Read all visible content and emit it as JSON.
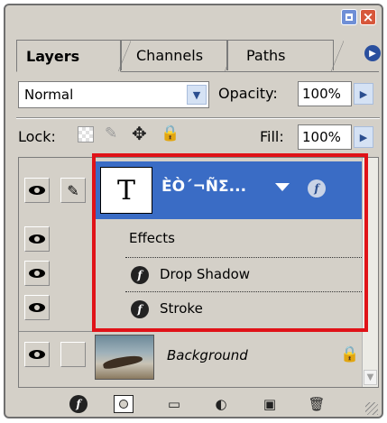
{
  "tabs": [
    {
      "label": "Layers",
      "active": true
    },
    {
      "label": "Channels",
      "active": false
    },
    {
      "label": "Paths",
      "active": false
    }
  ],
  "blend_mode": "Normal",
  "opacity": {
    "label": "Opacity:",
    "value": "100%"
  },
  "lock": {
    "label": "Lock:"
  },
  "fill": {
    "label": "Fill:",
    "value": "100%"
  },
  "layers": {
    "text_layer": {
      "thumb_glyph": "T",
      "name": "ÈÒ´¬ÑΣ...",
      "fx_badge": "f"
    },
    "effects": {
      "label": "Effects",
      "items": [
        "Drop Shadow",
        "Stroke"
      ]
    },
    "background": {
      "name": "Background"
    }
  },
  "colors": {
    "panel": "#d4d0c8",
    "selected_layer": "#3a6cc5",
    "highlight_box": "#e01218"
  }
}
